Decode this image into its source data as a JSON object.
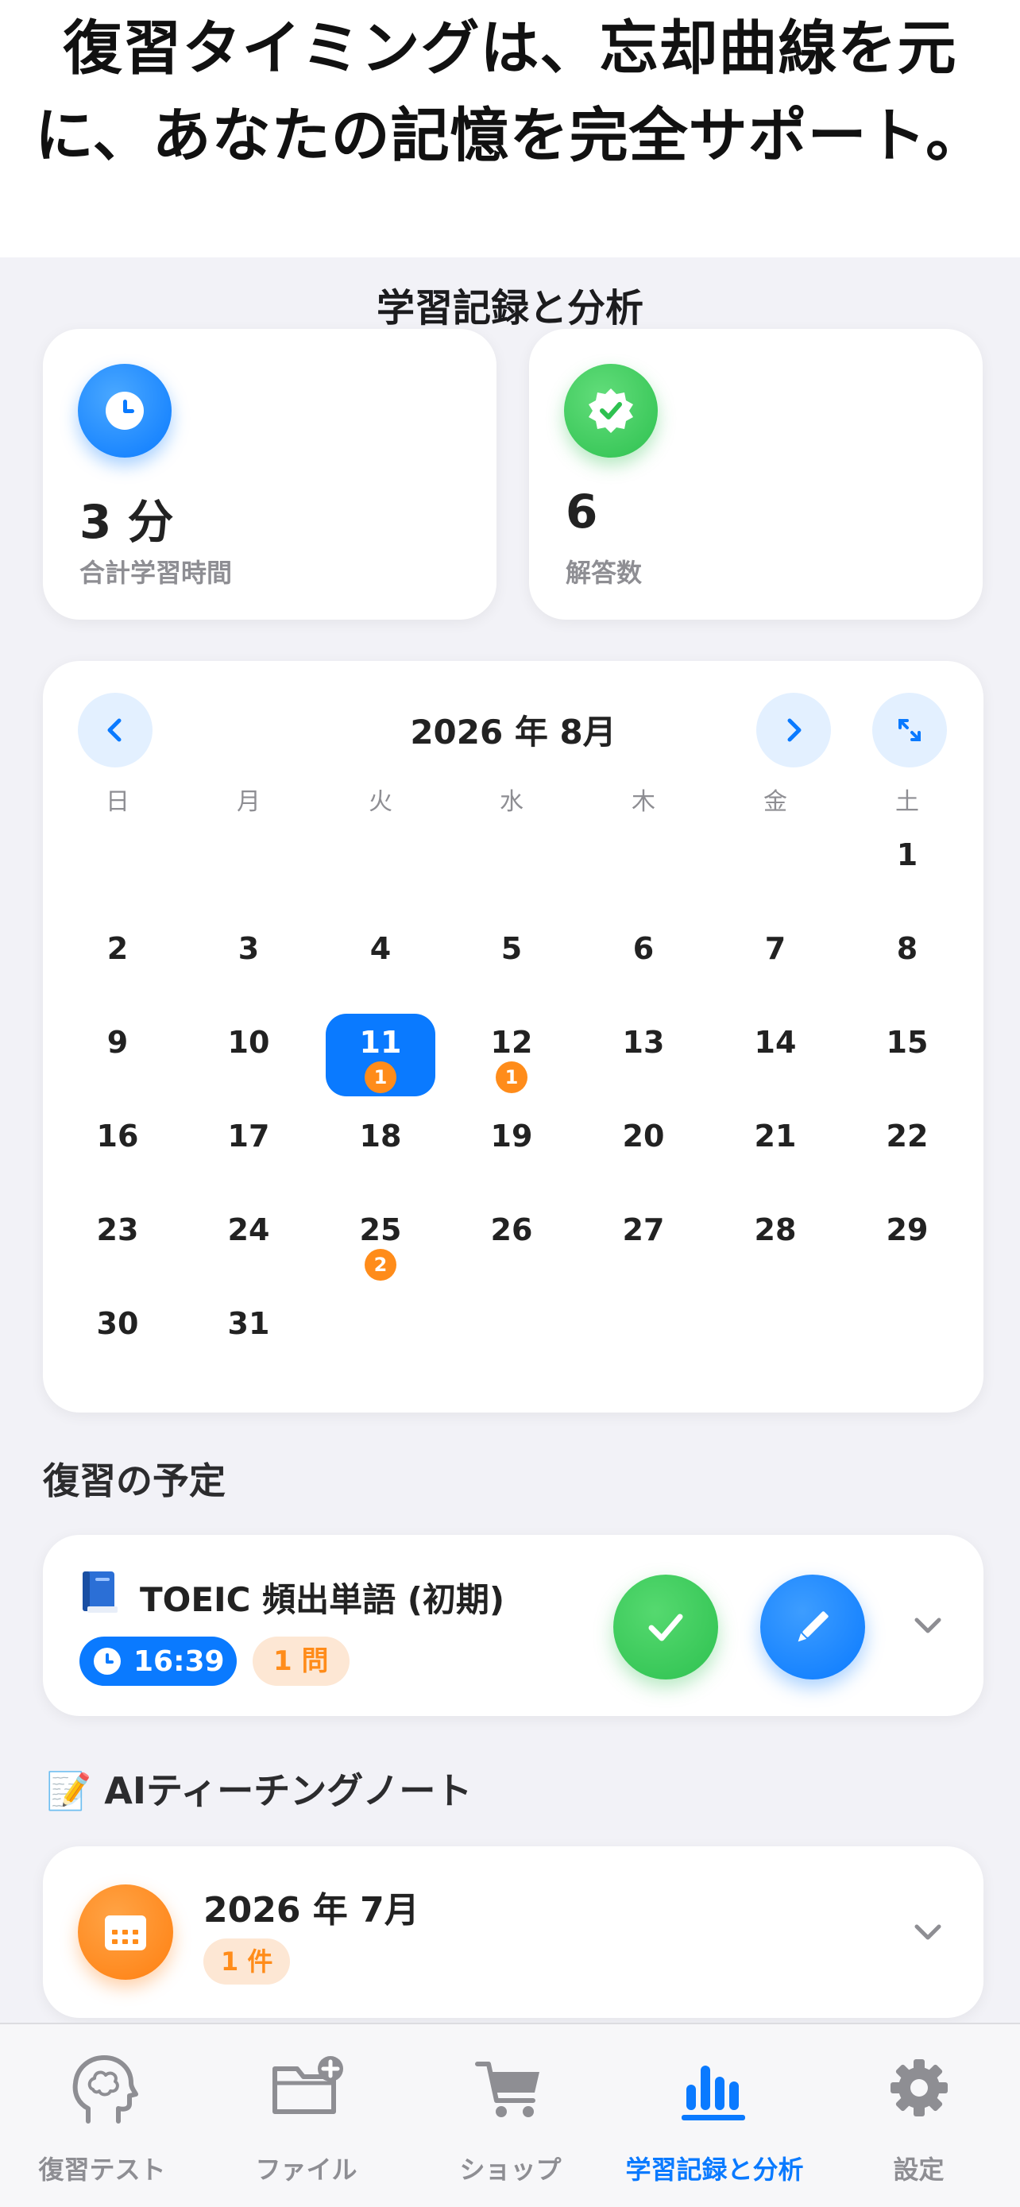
{
  "banner": {
    "line1": "復習タイミングは、忘却曲線を元",
    "line2": "に、あなたの記憶を完全サポート。"
  },
  "screen": {
    "title": "学習記録と分析"
  },
  "stats": {
    "time_value": "3 分",
    "time_label": "合計学習時間",
    "answers_value": "6",
    "answers_label": "解答数"
  },
  "calendar": {
    "title": "2026 年 8月",
    "weekdays": [
      "日",
      "月",
      "火",
      "水",
      "木",
      "金",
      "土"
    ],
    "first_weekday_index": 6,
    "days_in_month": 31,
    "selected_day": 11,
    "badges": {
      "11": "1",
      "12": "1",
      "25": "2"
    }
  },
  "review": {
    "section_title": "復習の予定",
    "item_title": "TOEIC 頻出単語 (初期)",
    "time": "16:39",
    "count": "1 問"
  },
  "notes": {
    "section_emoji": "📝",
    "section_title": "AIティーチングノート",
    "item_title": "2026 年 7月",
    "item_count": "1 件"
  },
  "tabs": [
    {
      "label": "復習テスト",
      "icon": "brain-head-icon"
    },
    {
      "label": "ファイル",
      "icon": "folder-plus-icon"
    },
    {
      "label": "ショップ",
      "icon": "cart-icon"
    },
    {
      "label": "学習記録と分析",
      "icon": "bar-chart-icon"
    },
    {
      "label": "設定",
      "icon": "gear-icon"
    }
  ],
  "colors": {
    "accent": "#0a7aff",
    "success": "#2ec150",
    "warning": "#ff8c1a",
    "background": "#f2f2f7"
  }
}
